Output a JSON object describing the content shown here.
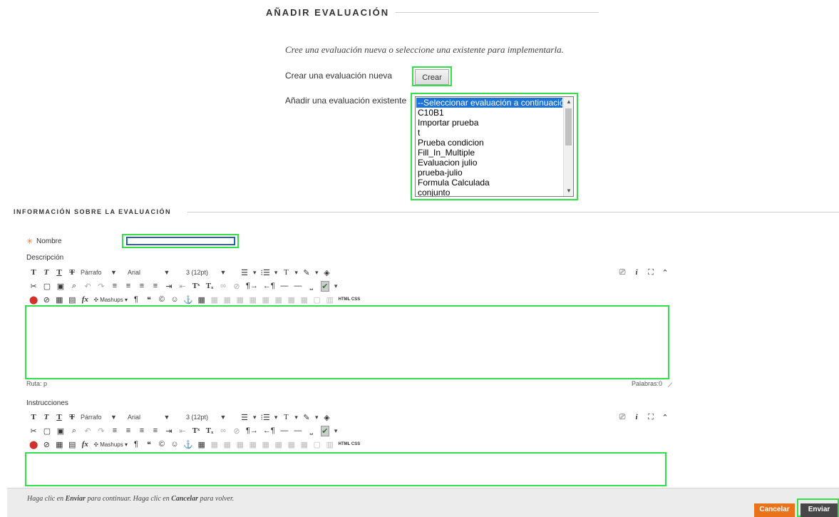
{
  "add_section": {
    "title": "AÑADIR EVALUACIÓN",
    "intro": "Cree una evaluación nueva o seleccione una existente para implementarla.",
    "create_label": "Crear una evaluación nueva",
    "create_button": "Crear",
    "existing_label": "Añadir una evaluación existente",
    "options": [
      "--Seleccionar evaluación a continuación--",
      "C10B1",
      "Importar prueba",
      "t",
      "Prueba condicion",
      "Fill_In_Multiple",
      "Evaluacion julio",
      "prueba-julio",
      "Formula Calculada",
      "conjunto"
    ]
  },
  "info_section": {
    "title": "INFORMACIÓN SOBRE LA EVALUACIÓN",
    "name_label": "Nombre",
    "name_value": "",
    "description_label": "Descripción",
    "instructions_label": "Instrucciones",
    "path_label": "Ruta: p",
    "words_label": "Palabras:0"
  },
  "toolbar": {
    "paragraph": "Párrafo",
    "font": "Arial",
    "size": "3 (12pt)",
    "mashups": "Mashups",
    "html_css": "HTML CSS"
  },
  "footer": {
    "hint_pre": "Haga clic en ",
    "hint_enviar": "Enviar",
    "hint_mid": " para continuar. Haga clic en ",
    "hint_cancelar": "Cancelar",
    "hint_post": " para volver.",
    "cancel_button": "Cancelar",
    "submit_button": "Enviar"
  },
  "colors": {
    "highlight": "#33e04a",
    "selected_option": "#1e73d6",
    "cancel": "#e9721b",
    "submit": "#474747",
    "required_star": "#e8732a"
  }
}
